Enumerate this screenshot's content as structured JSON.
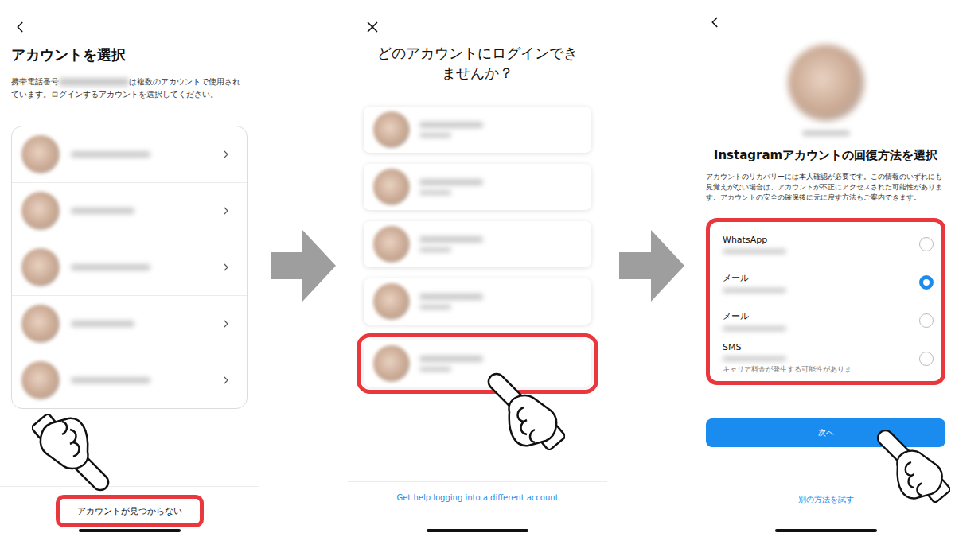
{
  "account_select": {
    "title": "アカウントを選択",
    "description_before": "携帯電話番号",
    "description_after": "は複数のアカウントで使用されています。ログインするアカウントを選択してください。",
    "accounts": [
      {
        "highlighted": false
      },
      {
        "highlighted": false
      },
      {
        "highlighted": false
      },
      {
        "highlighted": false
      },
      {
        "highlighted": false
      }
    ],
    "not_found_button": {
      "label": "アカウントが見つからない",
      "highlighted": true
    }
  },
  "trouble_select": {
    "title": "どのアカウントにログインできませんか？",
    "accounts": [
      {
        "highlighted": false
      },
      {
        "highlighted": false
      },
      {
        "highlighted": false
      },
      {
        "highlighted": false
      },
      {
        "highlighted": true
      }
    ],
    "help_link": "Get help logging into a different account"
  },
  "recovery": {
    "title": "Instagramアカウントの回復方法を選択",
    "description": "アカウントのリカバリーには本人確認が必要です。この情報のいずれにも見覚えがない場合は、アカウントが不正にアクセスされた可能性があります。アカウントの安全の確保後に元に戻す方法もご案内できます。",
    "options_highlighted": true,
    "options": [
      {
        "label": "WhatsApp",
        "selected": false
      },
      {
        "label": "メール",
        "selected": true
      },
      {
        "label": "メール",
        "selected": false
      },
      {
        "label": "SMS",
        "note": "キャリア料金が発生する可能性がありま",
        "selected": false
      }
    ],
    "next_button": "次へ",
    "alt_link": "別の方法を試す"
  }
}
